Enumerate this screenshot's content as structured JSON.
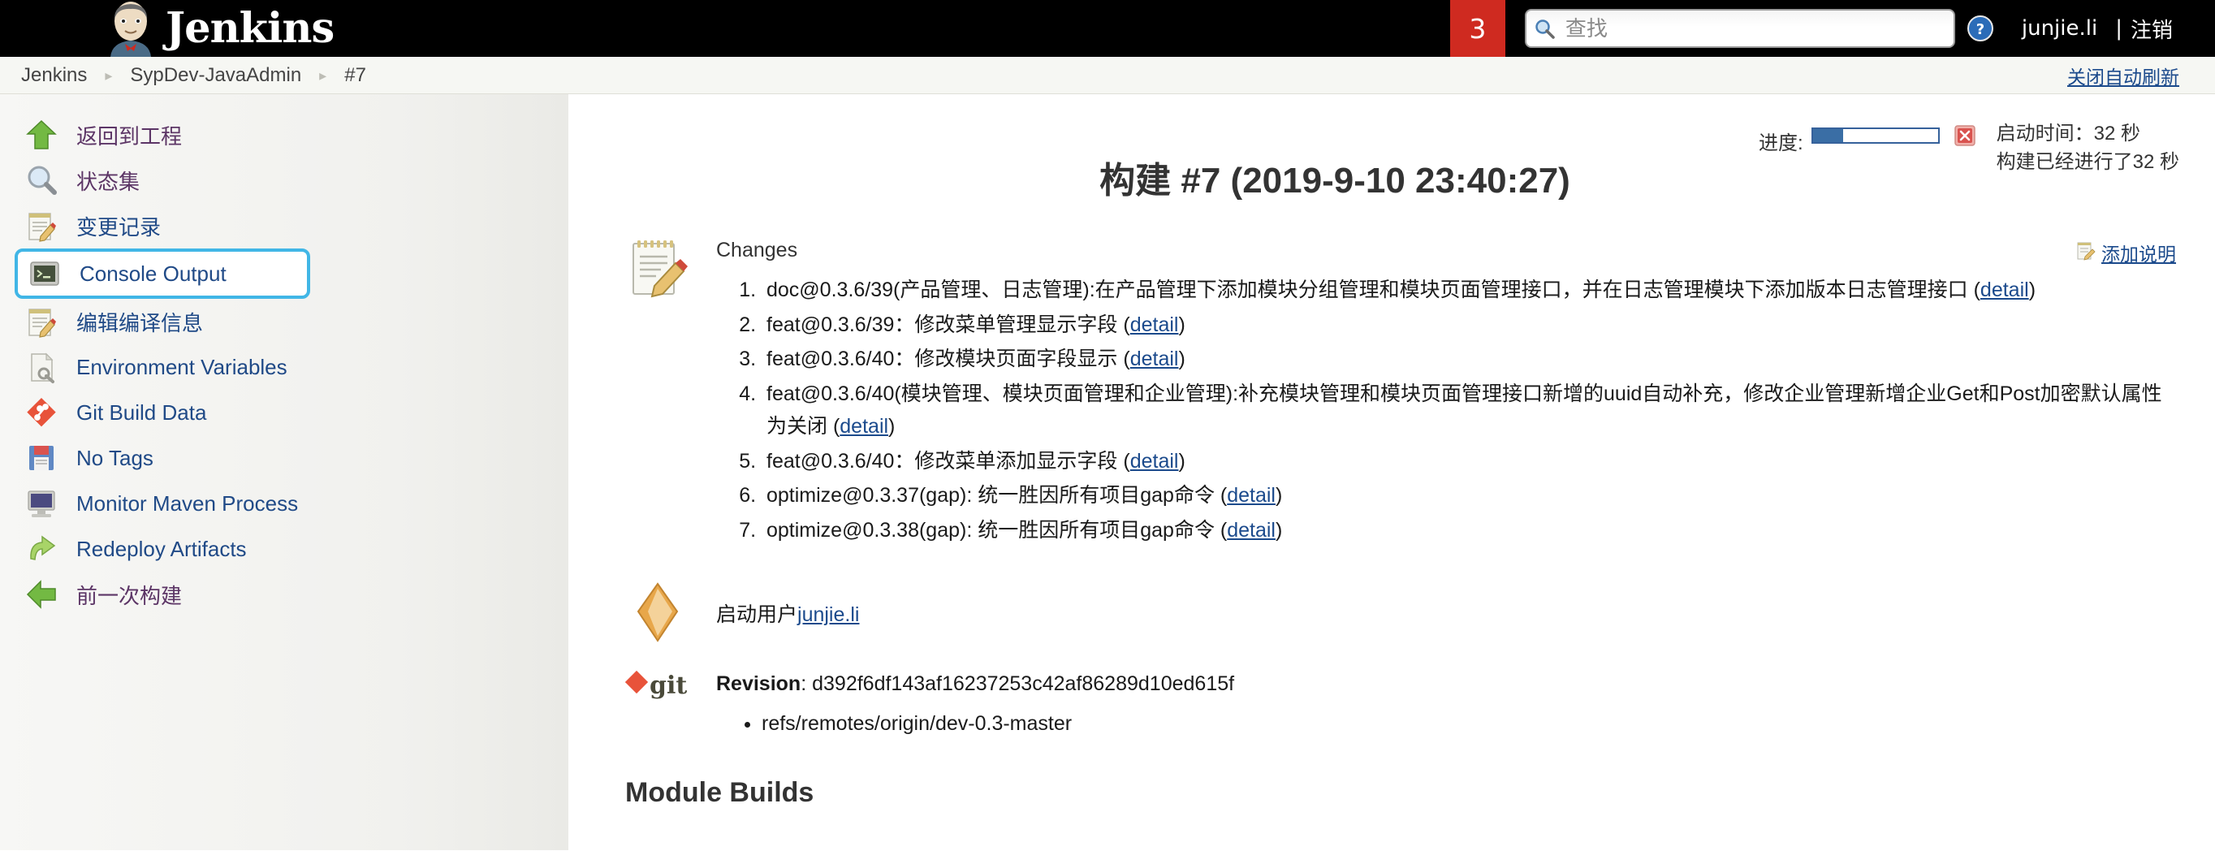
{
  "masthead": {
    "brand": "Jenkins",
    "executors_badge": "3",
    "search_placeholder": "查找",
    "search_value": "",
    "search_icon": "search-icon",
    "help_icon": "help-icon",
    "user_name": "junjie.li",
    "separator": "|",
    "logout_label": "注销"
  },
  "breadcrumb": {
    "items": [
      {
        "label": "Jenkins"
      },
      {
        "label": "SypDev-JavaAdmin"
      },
      {
        "label": "#7"
      }
    ],
    "arrow": "▸",
    "refresh_link": "关闭自动刷新"
  },
  "sidebar": {
    "items": [
      {
        "label": "返回到工程",
        "icon": "up-arrow-green-icon",
        "state": "visited"
      },
      {
        "label": "状态集",
        "icon": "magnifier-icon",
        "state": "visited"
      },
      {
        "label": "变更记录",
        "icon": "notepad-pencil-icon",
        "state": "normal"
      },
      {
        "label": "Console Output",
        "icon": "terminal-icon",
        "state": "focused"
      },
      {
        "label": "编辑编译信息",
        "icon": "notepad-pencil-icon",
        "state": "normal"
      },
      {
        "label": "Environment Variables",
        "icon": "document-wrench-icon",
        "state": "normal"
      },
      {
        "label": "Git Build Data",
        "icon": "git-diamond-icon",
        "state": "normal"
      },
      {
        "label": "No Tags",
        "icon": "floppy-disk-icon",
        "state": "normal"
      },
      {
        "label": "Monitor Maven Process",
        "icon": "computer-monitor-icon",
        "state": "normal"
      },
      {
        "label": "Redeploy Artifacts",
        "icon": "green-redo-arrow-icon",
        "state": "normal"
      },
      {
        "label": "前一次构建",
        "icon": "left-arrow-green-icon",
        "state": "visited"
      }
    ]
  },
  "main": {
    "title": "构建 #7 (2019-9-10 23:40:27)",
    "progress": {
      "label": "进度:",
      "percent": 24,
      "abort_icon": "abort-red-x-icon"
    },
    "timing": {
      "start": "启动时间：32 秒",
      "elapsed": "构建已经进行了32 秒"
    },
    "add_description": {
      "label": "添加说明",
      "icon": "notepad-pencil-icon"
    },
    "changes": {
      "icon": "notepad-pencil-icon",
      "heading": "Changes",
      "detail_label": "detail",
      "items": [
        "doc@0.3.6/39(产品管理、日志管理):在产品管理下添加模块分组管理和模块页面管理接口，并在日志管理模块下添加版本日志管理接口",
        "feat@0.3.6/39：修改菜单管理显示字段",
        "feat@0.3.6/40：修改模块页面字段显示",
        "feat@0.3.6/40(模块管理、模块页面管理和企业管理):补充模块管理和模块页面管理接口新增的uuid自动补充，修改企业管理新增企业Get和Post加密默认属性为关闭",
        "feat@0.3.6/40：修改菜单添加显示字段",
        "optimize@0.3.37(gap): 统一胜因所有项目gap命令",
        "optimize@0.3.38(gap): 统一胜因所有项目gap命令"
      ]
    },
    "started_by": {
      "icon": "user-diamond-icon",
      "prefix": "启动用户",
      "user": "junjie.li"
    },
    "revision": {
      "icon": "git-logo-icon",
      "label": "Revision",
      "sha": "d392f6df143af16237253c42af86289d10ed615f",
      "branches": [
        "refs/remotes/origin/dev-0.3-master"
      ]
    },
    "module_builds_heading": "Module Builds"
  },
  "colors": {
    "masthead_bg": "#000000",
    "executors_badge_bg": "#cf2a20",
    "link_blue": "#1b4a8c",
    "visited_purple": "#5c3566",
    "focus_ring": "#41b6e6",
    "progress_fill": "#3a6ea5",
    "breadcrumb_bg": "#f6f7f3"
  }
}
